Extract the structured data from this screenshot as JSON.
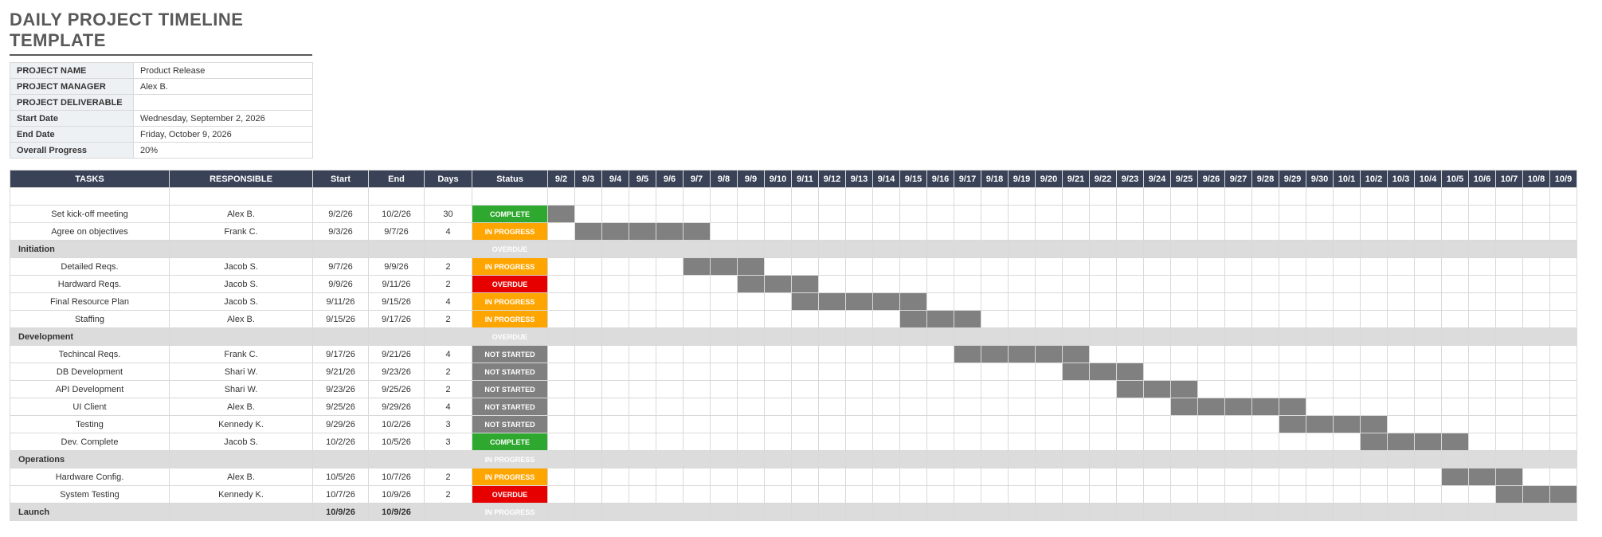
{
  "title": "DAILY PROJECT TIMELINE TEMPLATE",
  "meta": [
    {
      "label": "PROJECT NAME",
      "value": "Product Release"
    },
    {
      "label": "PROJECT MANAGER",
      "value": "Alex B."
    },
    {
      "label": "PROJECT DELIVERABLE",
      "value": ""
    },
    {
      "label": "Start Date",
      "value": "Wednesday, September 2, 2026"
    },
    {
      "label": "End Date",
      "value": "Friday, October 9, 2026"
    },
    {
      "label": "Overall Progress",
      "value": "20%"
    }
  ],
  "headers": {
    "task": "TASKS",
    "resp": "RESPONSIBLE",
    "start": "Start",
    "end": "End",
    "days": "Days",
    "status": "Status"
  },
  "dates": [
    "9/2",
    "9/3",
    "9/4",
    "9/5",
    "9/6",
    "9/7",
    "9/8",
    "9/9",
    "9/10",
    "9/11",
    "9/12",
    "9/13",
    "9/14",
    "9/15",
    "9/16",
    "9/17",
    "9/18",
    "9/19",
    "9/20",
    "9/21",
    "9/22",
    "9/23",
    "9/24",
    "9/25",
    "9/26",
    "9/27",
    "9/28",
    "9/29",
    "9/30",
    "10/1",
    "10/2",
    "10/3",
    "10/4",
    "10/5",
    "10/6",
    "10/7",
    "10/8",
    "10/9"
  ],
  "statusLabels": {
    "complete": "COMPLETE",
    "inprogress": "IN PROGRESS",
    "overdue": "OVERDUE",
    "notstarted": "NOT STARTED"
  },
  "rows": [
    {
      "type": "spacer"
    },
    {
      "type": "task",
      "task": "Set kick-off meeting",
      "resp": "Alex B.",
      "start": "9/2/26",
      "end": "10/2/26",
      "days": "30",
      "status": "complete",
      "barStart": 0,
      "barEnd": 0
    },
    {
      "type": "task",
      "task": "Agree on objectives",
      "resp": "Frank C.",
      "start": "9/3/26",
      "end": "9/7/26",
      "days": "4",
      "status": "inprogress",
      "barStart": 1,
      "barEnd": 5
    },
    {
      "type": "section",
      "task": "Initiation",
      "status": "overdue"
    },
    {
      "type": "task",
      "task": "Detailed Reqs.",
      "resp": "Jacob S.",
      "start": "9/7/26",
      "end": "9/9/26",
      "days": "2",
      "status": "inprogress",
      "barStart": 5,
      "barEnd": 7
    },
    {
      "type": "task",
      "task": "Hardward Reqs.",
      "resp": "Jacob S.",
      "start": "9/9/26",
      "end": "9/11/26",
      "days": "2",
      "status": "overdue",
      "barStart": 7,
      "barEnd": 9
    },
    {
      "type": "task",
      "task": "Final Resource Plan",
      "resp": "Jacob S.",
      "start": "9/11/26",
      "end": "9/15/26",
      "days": "4",
      "status": "inprogress",
      "barStart": 9,
      "barEnd": 13
    },
    {
      "type": "task",
      "task": "Staffing",
      "resp": "Alex B.",
      "start": "9/15/26",
      "end": "9/17/26",
      "days": "2",
      "status": "inprogress",
      "barStart": 13,
      "barEnd": 15
    },
    {
      "type": "section",
      "task": "Development",
      "status": "overdue"
    },
    {
      "type": "task",
      "task": "Techincal Reqs.",
      "resp": "Frank C.",
      "start": "9/17/26",
      "end": "9/21/26",
      "days": "4",
      "status": "notstarted",
      "barStart": 15,
      "barEnd": 19
    },
    {
      "type": "task",
      "task": "DB Development",
      "resp": "Shari W.",
      "start": "9/21/26",
      "end": "9/23/26",
      "days": "2",
      "status": "notstarted",
      "barStart": 19,
      "barEnd": 21
    },
    {
      "type": "task",
      "task": "API Development",
      "resp": "Shari W.",
      "start": "9/23/26",
      "end": "9/25/26",
      "days": "2",
      "status": "notstarted",
      "barStart": 21,
      "barEnd": 23
    },
    {
      "type": "task",
      "task": "UI Client",
      "resp": "Alex B.",
      "start": "9/25/26",
      "end": "9/29/26",
      "days": "4",
      "status": "notstarted",
      "barStart": 23,
      "barEnd": 27
    },
    {
      "type": "task",
      "task": "Testing",
      "resp": "Kennedy K.",
      "start": "9/29/26",
      "end": "10/2/26",
      "days": "3",
      "status": "notstarted",
      "barStart": 27,
      "barEnd": 30
    },
    {
      "type": "task",
      "task": "Dev. Complete",
      "resp": "Jacob S.",
      "start": "10/2/26",
      "end": "10/5/26",
      "days": "3",
      "status": "complete",
      "barStart": 30,
      "barEnd": 33
    },
    {
      "type": "section",
      "task": "Operations",
      "status": "inprogress"
    },
    {
      "type": "task",
      "task": "Hardware Config.",
      "resp": "Alex B.",
      "start": "10/5/26",
      "end": "10/7/26",
      "days": "2",
      "status": "inprogress",
      "barStart": 33,
      "barEnd": 35
    },
    {
      "type": "task",
      "task": "System Testing",
      "resp": "Kennedy K.",
      "start": "10/7/26",
      "end": "10/9/26",
      "days": "2",
      "status": "overdue",
      "barStart": 35,
      "barEnd": 37
    },
    {
      "type": "section",
      "task": "Launch",
      "start": "10/9/26",
      "end": "10/9/26",
      "status": "inprogress"
    }
  ]
}
